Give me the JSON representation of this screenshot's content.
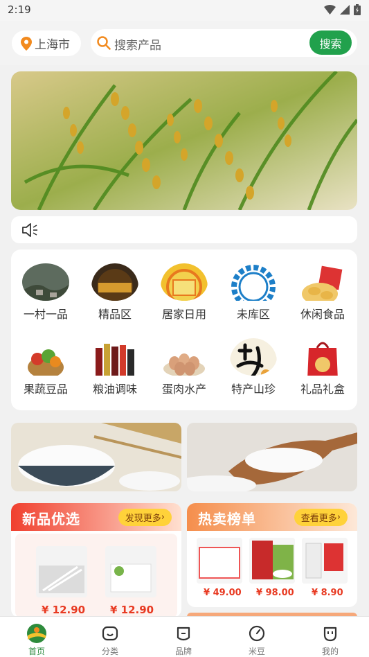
{
  "status_bar": {
    "time": "2:19"
  },
  "header": {
    "city": "上海市",
    "search_placeholder": "搜索产品",
    "search_button": "搜索"
  },
  "categories": [
    {
      "label": "一村一品",
      "icon": "village-photo"
    },
    {
      "label": "精品区",
      "icon": "premium-badge"
    },
    {
      "label": "居家日用",
      "icon": "home-goods-badge"
    },
    {
      "label": "未库区",
      "icon": "oem-gear"
    },
    {
      "label": "休闲食品",
      "icon": "snacks-photo"
    },
    {
      "label": "果蔬豆品",
      "icon": "vegetable-basket"
    },
    {
      "label": "粮油调味",
      "icon": "oil-bottles"
    },
    {
      "label": "蛋肉水产",
      "icon": "eggs"
    },
    {
      "label": "特产山珍",
      "icon": "specialty-calligraphy"
    },
    {
      "label": "礼品礼盒",
      "icon": "gift-box"
    }
  ],
  "panels": {
    "new": {
      "title": "新品优选",
      "more": "发现更多",
      "products": [
        {
          "price": "¥ 12.90"
        },
        {
          "price": "¥ 12.90"
        }
      ]
    },
    "hot": {
      "title": "热卖榜单",
      "more": "查看更多",
      "products": [
        {
          "price": "¥ 49.00"
        },
        {
          "price": "¥ 98.00"
        },
        {
          "price": "¥ 8.90"
        }
      ]
    }
  },
  "tabs": [
    {
      "label": "首页",
      "active": true
    },
    {
      "label": "分类"
    },
    {
      "label": "品牌"
    },
    {
      "label": "米豆"
    },
    {
      "label": "我的"
    }
  ],
  "colors": {
    "accent": "#21a14c",
    "price": "#e83a22",
    "panel_new": "#f04a3a",
    "panel_hot": "#f6a05a"
  }
}
